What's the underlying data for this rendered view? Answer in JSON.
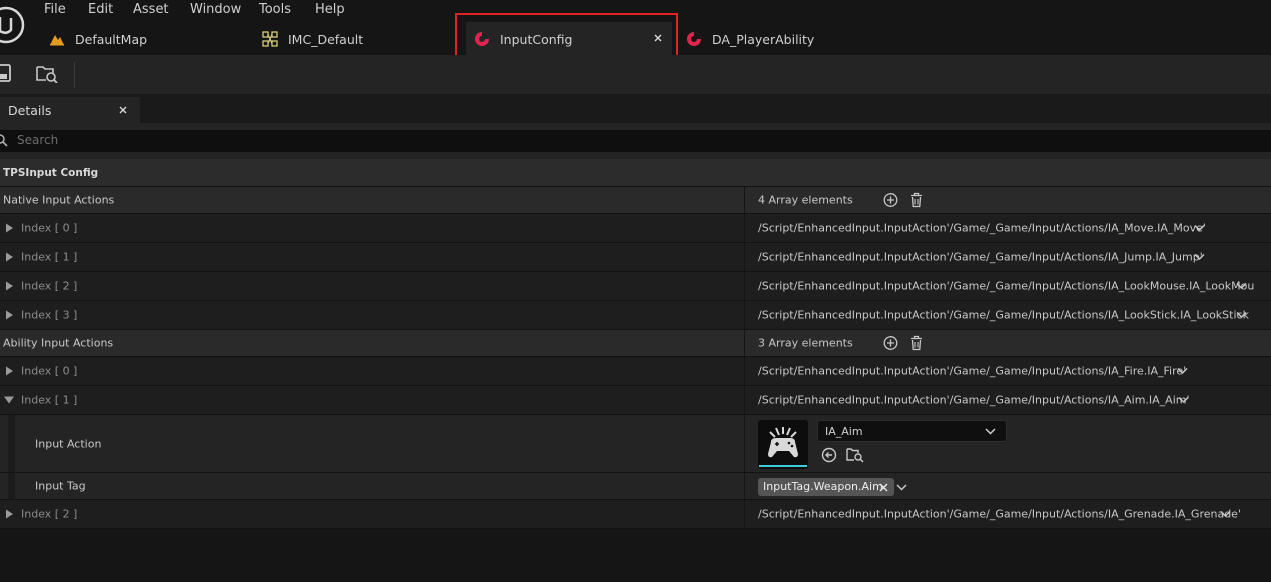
{
  "menu": [
    "File",
    "Edit",
    "Asset",
    "Window",
    "Tools",
    "Help"
  ],
  "tabs": [
    {
      "label": "DefaultMap",
      "icon": "level-map-icon",
      "color": "#e59b1f"
    },
    {
      "label": "IMC_Default",
      "icon": "input-mapping-context-icon",
      "color": "#d7cd7a"
    },
    {
      "label": "InputConfig",
      "icon": "data-asset-icon",
      "color": "#e0244e",
      "active": true
    },
    {
      "label": "DA_PlayerAbility",
      "icon": "data-asset-icon",
      "color": "#e0244e"
    }
  ],
  "toolbar": {
    "save_icon": "save-icon",
    "browse_icon": "browse-content-icon"
  },
  "panel": {
    "title": "Details"
  },
  "search": {
    "placeholder": "Search"
  },
  "category": {
    "label": "TPSInput Config"
  },
  "native": {
    "label": "Native Input Actions",
    "count": "4 Array elements",
    "items": [
      {
        "index": "Index [ 0 ]",
        "value": "/Script/EnhancedInput.InputAction'/Game/_Game/Input/Actions/IA_Move.IA_Move'"
      },
      {
        "index": "Index [ 1 ]",
        "value": "/Script/EnhancedInput.InputAction'/Game/_Game/Input/Actions/IA_Jump.IA_Jump'"
      },
      {
        "index": "Index [ 2 ]",
        "value": "/Script/EnhancedInput.InputAction'/Game/_Game/Input/Actions/IA_LookMouse.IA_LookMou"
      },
      {
        "index": "Index [ 3 ]",
        "value": "/Script/EnhancedInput.InputAction'/Game/_Game/Input/Actions/IA_LookStick.IA_LookStick"
      }
    ]
  },
  "ability": {
    "label": "Ability Input Actions",
    "count": "3 Array elements",
    "items": [
      {
        "index": "Index [ 0 ]",
        "value": "/Script/EnhancedInput.InputAction'/Game/_Game/Input/Actions/IA_Fire.IA_Fire'"
      },
      {
        "index": "Index [ 1 ]",
        "value": "/Script/EnhancedInput.InputAction'/Game/_Game/Input/Actions/IA_Aim.IA_Aim'"
      },
      {
        "index": "Index [ 2 ]",
        "value": "/Script/EnhancedInput.InputAction'/Game/_Game/Input/Actions/IA_Grenade.IA_Grenade'"
      }
    ],
    "expanded": {
      "input_action_label": "Input Action",
      "input_action_value": "IA_Aim",
      "input_tag_label": "Input Tag",
      "input_tag_value": "InputTag.Weapon.Aim"
    }
  }
}
